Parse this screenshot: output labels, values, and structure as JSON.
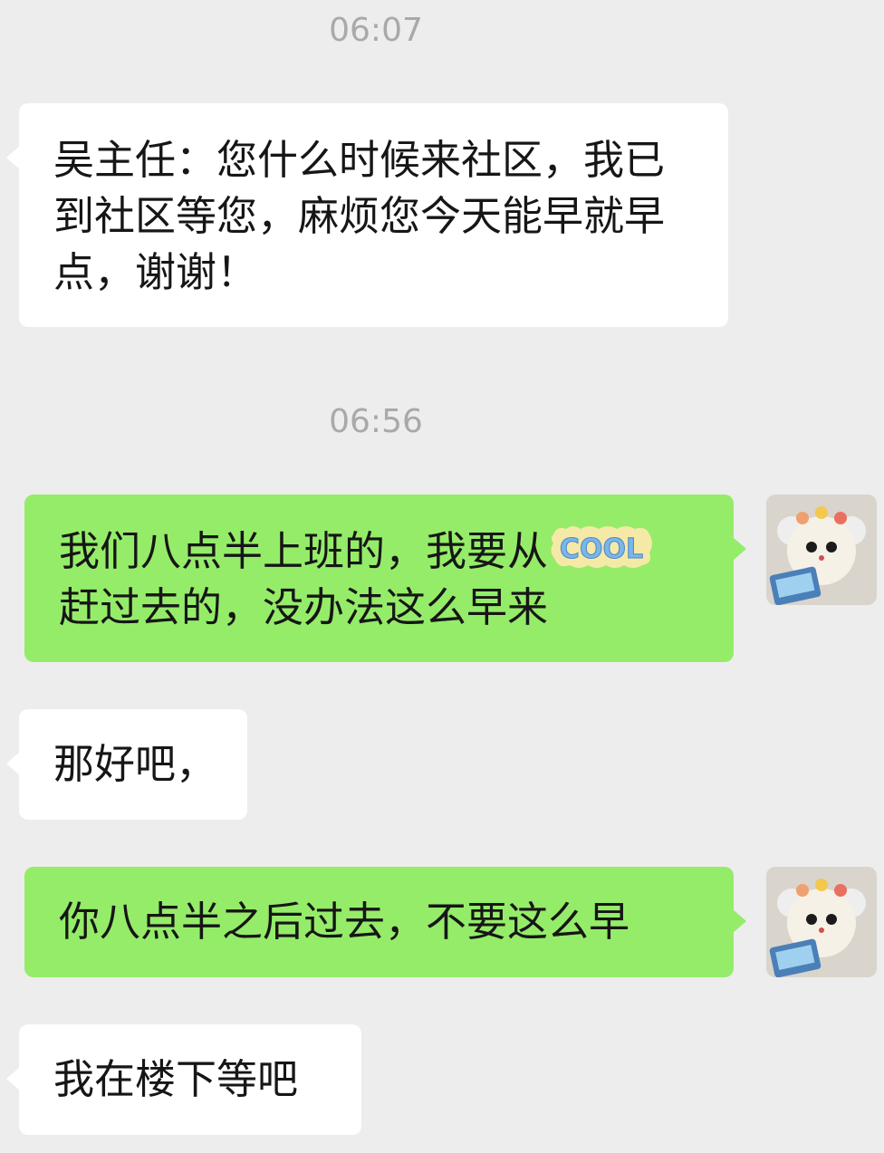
{
  "chat": {
    "time_1": "06:07",
    "msg_1": "吴主任：您什么时候来社区，我已到社区等您，麻烦您今天能早就早点，谢谢！",
    "time_2": "06:56",
    "msg_2_part1": "我们八点半上班的，我要从",
    "msg_2_sticker": "COOL",
    "msg_2_part2": "赶过去的，没办法这么早来",
    "msg_3": "那好吧，",
    "msg_4": "你八点半之后过去，不要这么早",
    "msg_5": "我在楼下等吧"
  },
  "colors": {
    "background": "#ededed",
    "incoming_bubble": "#ffffff",
    "outgoing_bubble": "#95ec69",
    "timestamp": "#a9a9a9"
  },
  "icons": {
    "avatar": "plush-toy-avatar"
  }
}
